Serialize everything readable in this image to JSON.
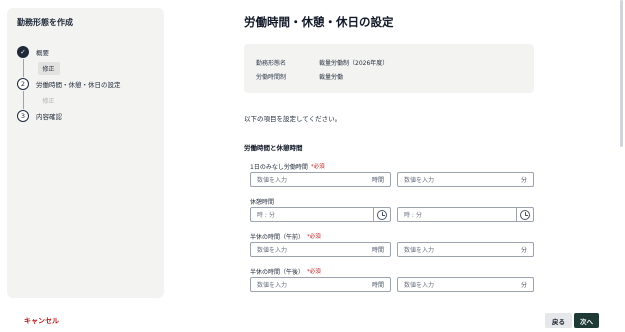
{
  "sidebar": {
    "title": "勤務形態を作成",
    "steps": [
      {
        "num": "✓",
        "label": "概要",
        "edit": "修正"
      },
      {
        "num": "2",
        "label": "労働時間・休憩・休日の設定",
        "edit": "修正"
      },
      {
        "num": "3",
        "label": "内容確認"
      }
    ]
  },
  "main": {
    "title": "労働時間・休憩・休日の設定",
    "info": [
      {
        "label": "勤務形態名",
        "value": "裁量労働制（2026年度）"
      },
      {
        "label": "労働時間制",
        "value": "裁量労働"
      }
    ],
    "instruction": "以下の項目を設定してください。",
    "section_title": "労働時間と休憩時間",
    "required_mark": "*必須",
    "fields": [
      {
        "label": "1日のみなし労働時間",
        "required": true,
        "left_placeholder": "数値を入力",
        "left_unit": "時間",
        "right_placeholder": "数値を入力",
        "right_unit": "分"
      },
      {
        "label": "休憩時間",
        "required": false,
        "left_placeholder": "時 : 分",
        "right_placeholder": "時 : 分"
      },
      {
        "label": "半休の時間（午前）",
        "required": true,
        "left_placeholder": "数値を入力",
        "left_unit": "時間",
        "right_placeholder": "数値を入力",
        "right_unit": "分"
      },
      {
        "label": "半休の時間（午後）",
        "required": true,
        "left_placeholder": "数値を入力",
        "left_unit": "時間",
        "right_placeholder": "数値を入力",
        "right_unit": "分"
      }
    ]
  },
  "footer": {
    "cancel": "キャンセル",
    "back": "戻る",
    "next": "次へ"
  }
}
